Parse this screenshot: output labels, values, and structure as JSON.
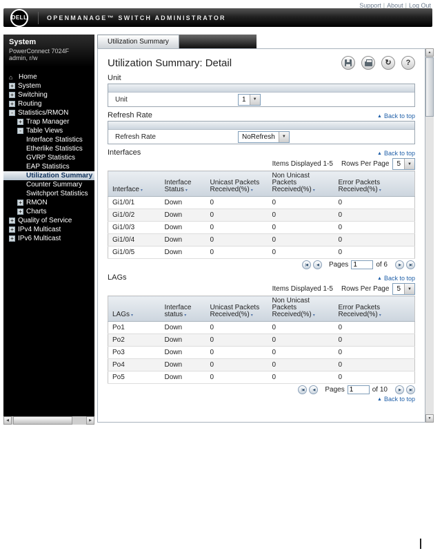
{
  "icons": {
    "sort": "▾",
    "up_arrow": "▲",
    "down_arrow": "▼",
    "left_arrow": "◀",
    "right_arrow": "▶",
    "first": "|◀",
    "prev": "◀",
    "next": "▶",
    "last": "▶|",
    "refresh": "↻",
    "help": "?",
    "home": "⌂",
    "select_arrow": "▼"
  },
  "header": {
    "brand": "DELL",
    "app_title": "OPENMANAGE™ SWITCH ADMINISTRATOR",
    "link_separator": "|",
    "links": [
      "Support",
      "About",
      "Log Out"
    ]
  },
  "sidebar": {
    "system": "System",
    "device": "PowerConnect 7024F",
    "user": "admin, r/w",
    "tree": [
      {
        "label": "Home",
        "level": 0,
        "icon": "home"
      },
      {
        "label": "System",
        "level": 0,
        "expand": "+"
      },
      {
        "label": "Switching",
        "level": 0,
        "expand": "+"
      },
      {
        "label": "Routing",
        "level": 0,
        "expand": "+"
      },
      {
        "label": "Statistics/RMON",
        "level": 0,
        "expand": "-"
      },
      {
        "label": "Trap Manager",
        "level": 1,
        "expand": "+"
      },
      {
        "label": "Table Views",
        "level": 1,
        "expand": "-"
      },
      {
        "label": "Interface Statistics",
        "level": 2
      },
      {
        "label": "Etherlike Statistics",
        "level": 2
      },
      {
        "label": "GVRP Statistics",
        "level": 2
      },
      {
        "label": "EAP Statistics",
        "level": 2
      },
      {
        "label": "Utilization Summary",
        "level": 2,
        "selected": true
      },
      {
        "label": "Counter Summary",
        "level": 2
      },
      {
        "label": "Switchport Statistics",
        "level": 2
      },
      {
        "label": "RMON",
        "level": 1,
        "expand": "+"
      },
      {
        "label": "Charts",
        "level": 1,
        "expand": "+"
      },
      {
        "label": "Quality of Service",
        "level": 0,
        "expand": "+"
      },
      {
        "label": "IPv4 Multicast",
        "level": 0,
        "expand": "+"
      },
      {
        "label": "IPv6 Multicast",
        "level": 0,
        "expand": "+"
      }
    ]
  },
  "tab": {
    "label": "Utilization Summary"
  },
  "main": {
    "title": "Utilization Summary: Detail",
    "back_to_top": "Back to top",
    "unit": {
      "heading": "Unit",
      "label": "Unit",
      "value": "1"
    },
    "refresh_rate": {
      "heading": "Refresh Rate",
      "label": "Refresh Rate",
      "value": "NoRefresh"
    },
    "interfaces": {
      "heading": "Interfaces",
      "items_displayed": "Items Displayed 1-5",
      "rows_per_page_label": "Rows Per Page",
      "rows_per_page_value": "5",
      "columns": [
        "Interface",
        "Interface Status",
        "Unicast Packets Received(%)",
        "Non Unicast Packets Received(%)",
        "Error Packets Received(%)"
      ],
      "rows": [
        [
          "Gi1/0/1",
          "Down",
          "0",
          "0",
          "0"
        ],
        [
          "Gi1/0/2",
          "Down",
          "0",
          "0",
          "0"
        ],
        [
          "Gi1/0/3",
          "Down",
          "0",
          "0",
          "0"
        ],
        [
          "Gi1/0/4",
          "Down",
          "0",
          "0",
          "0"
        ],
        [
          "Gi1/0/5",
          "Down",
          "0",
          "0",
          "0"
        ]
      ],
      "pages_label": "Pages",
      "page_value": "1",
      "of_label": "of 6"
    },
    "lags": {
      "heading": "LAGs",
      "items_displayed": "Items Displayed 1-5",
      "rows_per_page_label": "Rows Per Page",
      "rows_per_page_value": "5",
      "columns": [
        "LAGs",
        "Interface status",
        "Unicast Packets Received(%)",
        "Non Unicast Packets Received(%)",
        "Error Packets Received(%)"
      ],
      "rows": [
        [
          "Po1",
          "Down",
          "0",
          "0",
          "0"
        ],
        [
          "Po2",
          "Down",
          "0",
          "0",
          "0"
        ],
        [
          "Po3",
          "Down",
          "0",
          "0",
          "0"
        ],
        [
          "Po4",
          "Down",
          "0",
          "0",
          "0"
        ],
        [
          "Po5",
          "Down",
          "0",
          "0",
          "0"
        ]
      ],
      "pages_label": "Pages",
      "page_value": "1",
      "of_label": "of 10"
    }
  }
}
